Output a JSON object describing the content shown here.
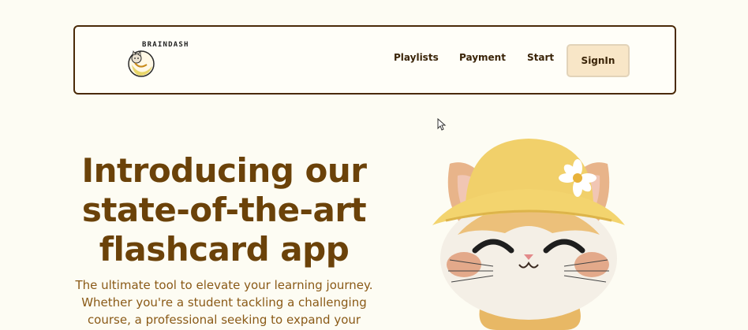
{
  "navbar": {
    "logo_text": "BRAINDASH",
    "links": [
      {
        "label": "Playlists"
      },
      {
        "label": "Payment"
      },
      {
        "label": "Start"
      }
    ],
    "signin_label": "SignIn"
  },
  "hero": {
    "title": "Introducing our state-of-the-art flashcard app",
    "description": "The ultimate tool to elevate your learning journey. Whether you're a student tackling a challenging course, a professional seeking to expand your expertise, or a"
  },
  "colors": {
    "background": "#fdfcf3",
    "nav_border": "#4a2a08",
    "signin_bg": "#f8e6c7",
    "title": "#6b4209",
    "body_text": "#8a5a17"
  },
  "icons": {
    "logo": "cat-mascot-logo-icon",
    "mascot": "cat-with-yellow-hat-icon",
    "cursor": "mouse-pointer-icon"
  }
}
